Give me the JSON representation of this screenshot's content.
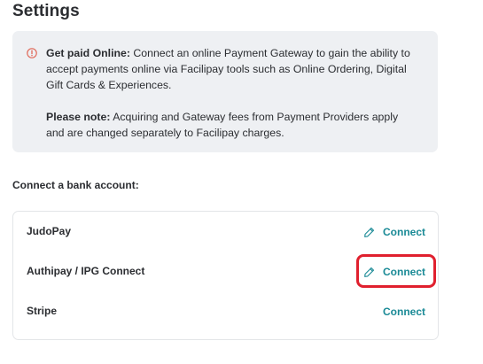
{
  "page": {
    "title": "Settings"
  },
  "notice": {
    "icon": "alert-circle-icon",
    "icon_color": "#e06a5a",
    "paragraph1_bold": "Get paid Online:",
    "paragraph1_text": " Connect an online Payment Gateway to gain the ability to accept payments online via Facilipay tools such as Online Ordering, Digital Gift Cards & Experiences.",
    "paragraph2_bold": "Please note:",
    "paragraph2_text": " Acquiring and Gateway fees from Payment Providers apply and are changed separately to Facilipay charges."
  },
  "bank": {
    "section_label": "Connect a bank account:",
    "providers": [
      {
        "name": "JudoPay",
        "action_label": "Connect",
        "action_icon": "pencil-icon"
      },
      {
        "name": "Authipay / IPG Connect",
        "action_label": "Connect",
        "action_icon": "pencil-icon"
      },
      {
        "name": "Stripe",
        "action_label": "Connect",
        "action_icon": ""
      }
    ]
  },
  "colors": {
    "accent": "#1a8a96",
    "highlight": "#e0202e"
  }
}
